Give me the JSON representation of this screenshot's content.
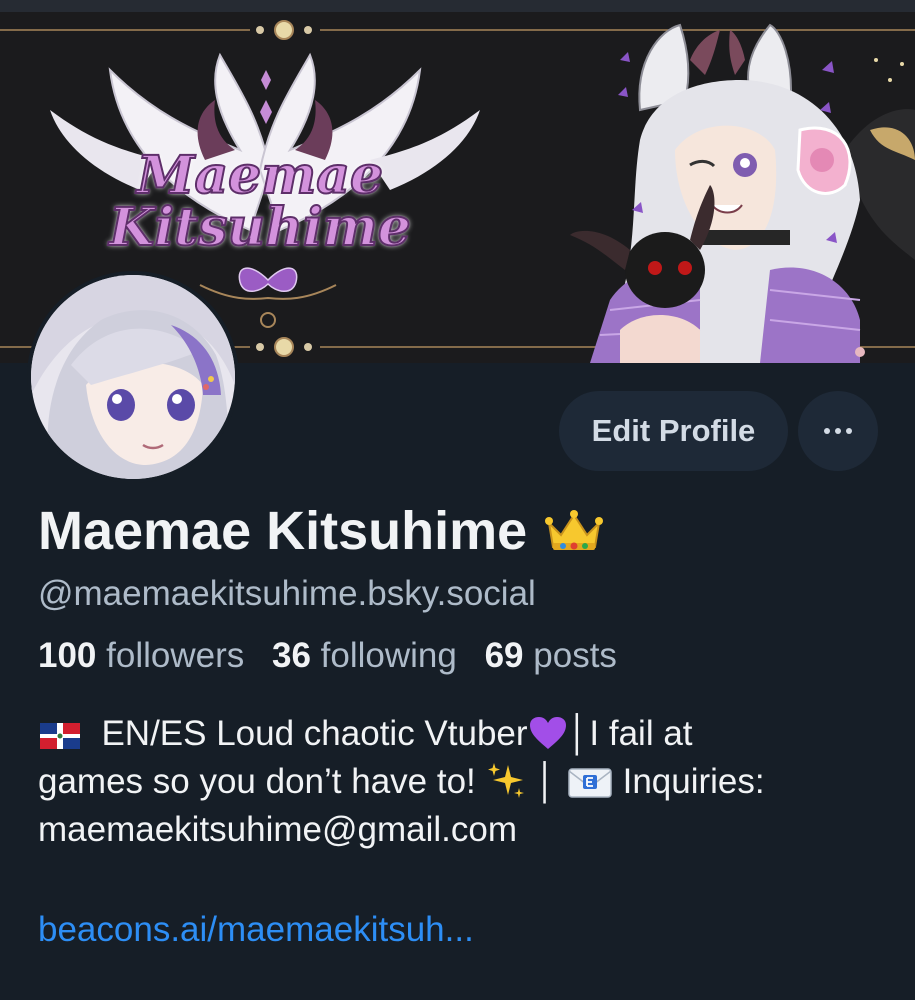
{
  "banner": {
    "title_line1": "Maemae",
    "title_line2": "Kitsuhime"
  },
  "profile": {
    "display_name": "Maemae Kitsuhime",
    "name_emoji": "crown-emoji",
    "handle": "@maemaekitsuhime.bsky.social",
    "followers_count": "100",
    "followers_label": "followers",
    "following_count": "36",
    "following_label": "following",
    "posts_count": "69",
    "posts_label": "posts"
  },
  "actions": {
    "edit_profile_label": "Edit Profile",
    "more_icon": "ellipsis-icon"
  },
  "bio": {
    "line1_text": "EN/ES Loud chaotic Vtuber",
    "line1_sep": "│I fail at",
    "line2_text": "games so you don’t have to!",
    "line2_sep": "│",
    "line2_tail": "Inquiries:",
    "line3": "maemaekitsuhime@gmail.com",
    "link_text": "beacons.ai/maemaekitsuh..."
  },
  "colors": {
    "background": "#161e27",
    "button_bg": "#1e2937",
    "secondary_text": "#aebbc9",
    "link": "#2d8ef5",
    "banner_accent": "#d392dc"
  }
}
